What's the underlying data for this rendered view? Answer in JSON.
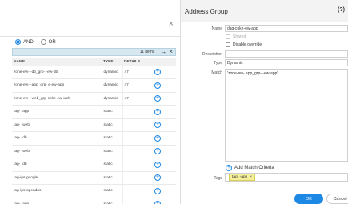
{
  "left": {
    "close_glyph": "×",
    "operator": {
      "and_label": "AND",
      "or_label": "OR",
      "selected": "AND"
    },
    "filter": {
      "count": "11 items",
      "apply_glyph": "→",
      "clear_glyph": "×"
    },
    "columns": [
      "NAME",
      "TYPE",
      "DETAILS"
    ],
    "rows": [
      {
        "name": "zone-ew-   -db_grp-   -ew-db",
        "type": "dynamic",
        "details": "47"
      },
      {
        "name": "zone-ew-   -app_grp-   e-ew-app",
        "type": "dynamic",
        "details": "47"
      },
      {
        "name": "zone-ew-   -web_grp-coke-ew-web",
        "type": "dynamic",
        "details": "47"
      },
      {
        "name": "tag-    -app",
        "type": "static",
        "details": ""
      },
      {
        "name": "tag-    -web",
        "type": "static",
        "details": ""
      },
      {
        "name": "tag-    -db",
        "type": "static",
        "details": ""
      },
      {
        "name": "tag-    -web",
        "type": "static",
        "details": ""
      },
      {
        "name": "tag-    -db",
        "type": "static",
        "details": ""
      },
      {
        "name": "tag-ips-google",
        "type": "static",
        "details": ""
      },
      {
        "name": "tag-ips-opendns",
        "type": "static",
        "details": ""
      },
      {
        "name": "tag-    -app",
        "type": "static",
        "details": ""
      }
    ]
  },
  "right": {
    "title": "Address Group",
    "help_glyph": "?",
    "labels": {
      "name": "Name",
      "description": "Description",
      "type": "Type",
      "match": "Match",
      "tags": "Tags"
    },
    "name_value": "dag-coke-ew-app",
    "shared_label": "Shared",
    "disable_override_label": "Disable override",
    "description_value": "",
    "type_value": "Dynamic",
    "match_value": "'zone-ew-    app_grp-    -ew-app'",
    "add_match_label": "Add Match Criteria",
    "tag_value": "tag-    -app",
    "tag_remove_glyph": "×",
    "ok_label": "OK",
    "cancel_label": "Cancel"
  }
}
